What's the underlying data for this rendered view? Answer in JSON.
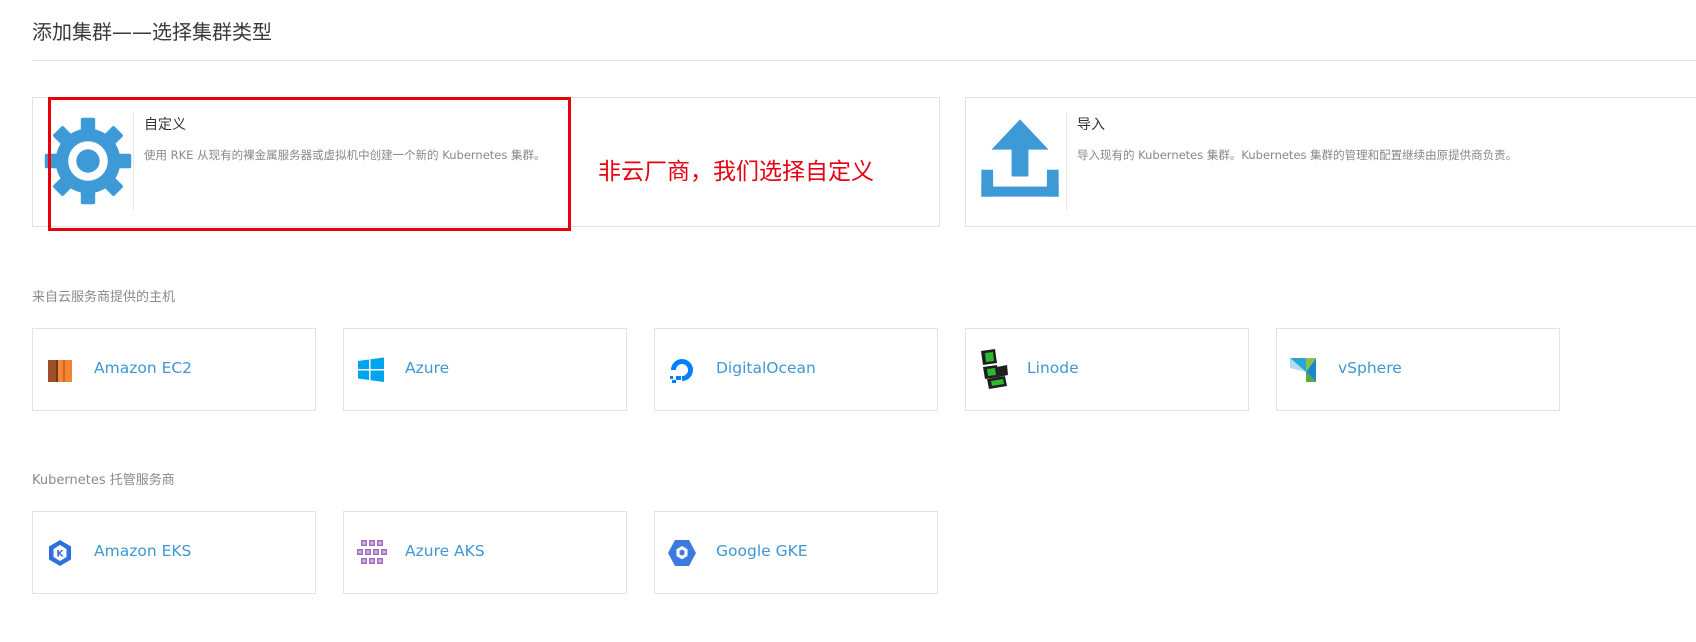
{
  "page": {
    "title": "添加集群——选择集群类型"
  },
  "cluster_types": {
    "custom": {
      "title": "自定义",
      "description": "使用 RKE 从现有的裸金属服务器或虚拟机中创建一个新的 Kubernetes 集群。",
      "icon": "gear-icon"
    },
    "import": {
      "title": "导入",
      "description": "导入现有的 Kubernetes 集群。Kubernetes 集群的管理和配置继续由原提供商负责。",
      "icon": "upload-icon"
    }
  },
  "annotation": {
    "text": "非云厂商，我们选择自定义",
    "color": "#e60012"
  },
  "cloud_hosts": {
    "label": "来自云服务商提供的主机",
    "providers": [
      {
        "label": "Amazon EC2",
        "icon": "amazon-ec2-icon"
      },
      {
        "label": "Azure",
        "icon": "azure-icon"
      },
      {
        "label": "DigitalOcean",
        "icon": "digitalocean-icon"
      },
      {
        "label": "Linode",
        "icon": "linode-icon"
      },
      {
        "label": "vSphere",
        "icon": "vsphere-icon"
      }
    ]
  },
  "k8s_services": {
    "label": "Kubernetes 托管服务商",
    "providers": [
      {
        "label": "Amazon EKS",
        "icon": "amazon-eks-icon"
      },
      {
        "label": "Azure AKS",
        "icon": "azure-aks-icon"
      },
      {
        "label": "Google GKE",
        "icon": "google-gke-icon"
      }
    ]
  },
  "colors": {
    "accent": "#3d98d3",
    "icon_blue": "#3e9ad6",
    "highlight": "#e8000b"
  }
}
